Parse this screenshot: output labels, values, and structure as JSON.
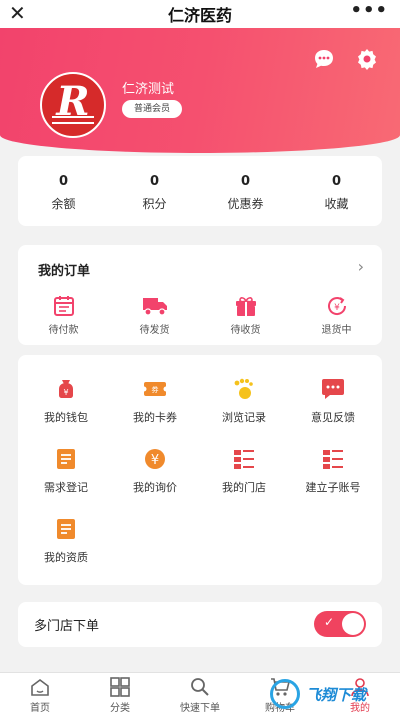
{
  "topbar": {
    "title": "仁济医药",
    "close_icon": "close-icon",
    "more_icon": "more-icon"
  },
  "profile": {
    "username": "仁济测试",
    "member_level": "普通会员",
    "avatar_letter": "R",
    "icons": [
      "message-icon",
      "gear-icon"
    ]
  },
  "stats": [
    {
      "value": "0",
      "label": "余额"
    },
    {
      "value": "0",
      "label": "积分"
    },
    {
      "value": "0",
      "label": "优惠券"
    },
    {
      "value": "0",
      "label": "收藏"
    }
  ],
  "orders": {
    "title": "我的订单",
    "items": [
      {
        "label": "待付款",
        "icon": "calendar-icon"
      },
      {
        "label": "待发货",
        "icon": "truck-icon"
      },
      {
        "label": "待收货",
        "icon": "gift-box-icon"
      },
      {
        "label": "退货中",
        "icon": "refund-icon"
      }
    ]
  },
  "services": [
    {
      "label": "我的钱包",
      "icon": "wallet-icon"
    },
    {
      "label": "我的卡券",
      "icon": "coupon-icon"
    },
    {
      "label": "浏览记录",
      "icon": "footprint-icon"
    },
    {
      "label": "意见反馈",
      "icon": "feedback-icon"
    },
    {
      "label": "需求登记",
      "icon": "document-icon"
    },
    {
      "label": "我的询价",
      "icon": "price-icon"
    },
    {
      "label": "我的门店",
      "icon": "store-list-icon"
    },
    {
      "label": "建立子账号",
      "icon": "subaccount-icon"
    },
    {
      "label": "我的资质",
      "icon": "certificate-icon"
    }
  ],
  "multi_store": {
    "label": "多门店下单",
    "enabled": true
  },
  "tabbar": [
    {
      "label": "首页",
      "icon": "home-icon"
    },
    {
      "label": "分类",
      "icon": "grid-icon"
    },
    {
      "label": "快速下单",
      "icon": "search-icon"
    },
    {
      "label": "购物车",
      "icon": "cart-icon"
    },
    {
      "label": "我的",
      "icon": "user-icon"
    }
  ],
  "colors": {
    "accent": "#f2436c",
    "icon_orange": "#f08a2c",
    "icon_red": "#e5474b",
    "icon_yellow": "#f5c21c"
  },
  "watermark": "飞翔下载"
}
